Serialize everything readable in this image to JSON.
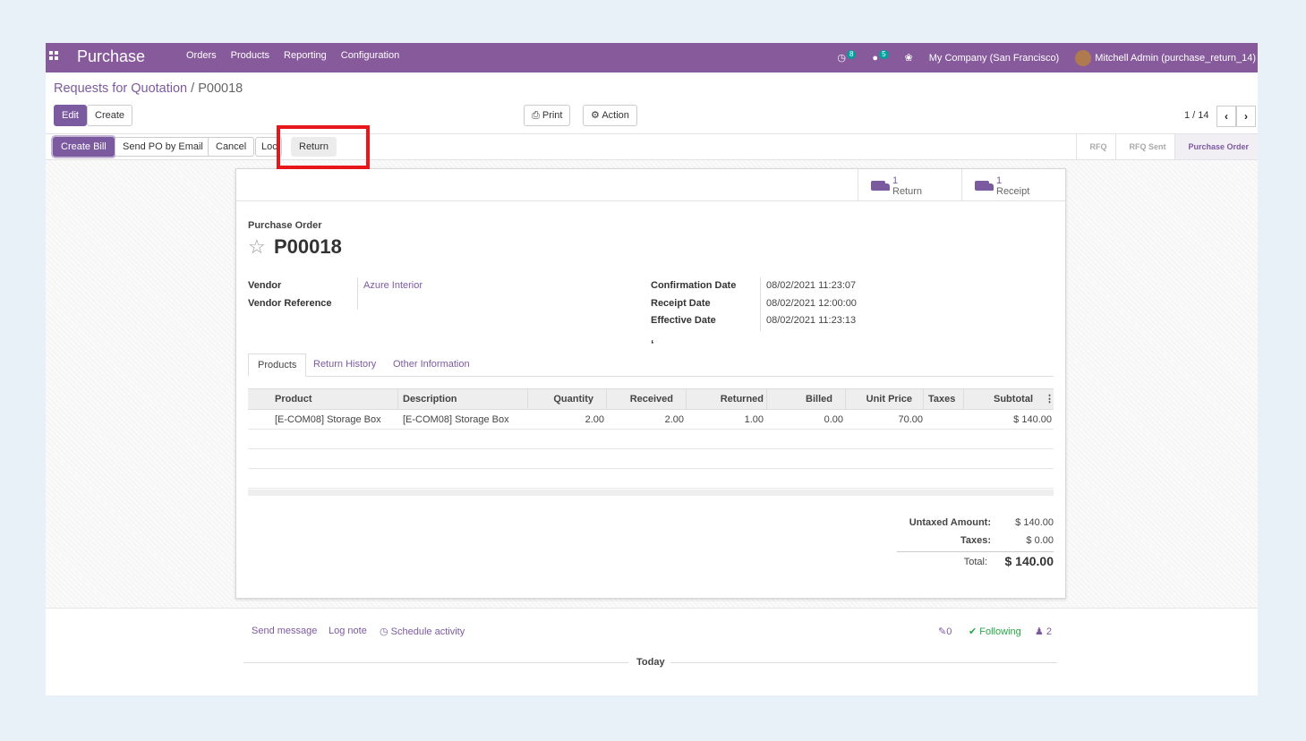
{
  "navbar": {
    "brand": "Purchase",
    "menu": [
      "Orders",
      "Products",
      "Reporting",
      "Configuration"
    ],
    "activity_count": "8",
    "message_count": "5",
    "company": "My Company (San Francisco)",
    "user": "Mitchell Admin (purchase_return_14)"
  },
  "breadcrumb": {
    "parent": "Requests for Quotation",
    "separator": " / ",
    "current": "P00018"
  },
  "toolbar": {
    "edit": "Edit",
    "create": "Create",
    "print": "Print",
    "action": "Action",
    "pager": "1 / 14"
  },
  "statusbar": {
    "buttons": [
      "Create Bill",
      "Send PO by Email",
      "Cancel",
      "Loc",
      "Return"
    ],
    "stages": [
      "RFQ",
      "RFQ Sent",
      "Purchase Order"
    ],
    "active_stage": "Purchase Order"
  },
  "smart_buttons": [
    {
      "count": "1",
      "label": "Return",
      "icon": "truck-icon"
    },
    {
      "count": "1",
      "label": "Receipt",
      "icon": "truck-icon"
    }
  ],
  "form": {
    "type": "Purchase Order",
    "name": "P00018",
    "vendor_label": "Vendor",
    "vendor": "Azure Interior",
    "vendor_ref_label": "Vendor Reference",
    "confirmation_label": "Confirmation Date",
    "confirmation_date": "08/02/2021 11:23:07",
    "receipt_label": "Receipt Date",
    "receipt_date": "08/02/2021 12:00:00",
    "effective_label": "Effective Date",
    "effective_date": "08/02/2021 11:23:13",
    "stray_mark": "‘"
  },
  "tabs": [
    "Products",
    "Return History",
    "Other Information"
  ],
  "lines": {
    "columns": [
      "Product",
      "Description",
      "Quantity",
      "Received",
      "Returned",
      "Billed",
      "Unit Price",
      "Taxes",
      "Subtotal"
    ],
    "rows": [
      [
        "[E-COM08] Storage Box",
        "[E-COM08] Storage Box",
        "2.00",
        "2.00",
        "1.00",
        "0.00",
        "70.00",
        "",
        "$ 140.00"
      ]
    ]
  },
  "totals": {
    "untaxed_label": "Untaxed Amount:",
    "untaxed": "$ 140.00",
    "taxes_label": "Taxes:",
    "taxes": "$ 0.00",
    "total_label": "Total:",
    "total": "$ 140.00"
  },
  "chatter": {
    "send_message": "Send message",
    "log_note": "Log note",
    "schedule": "Schedule activity",
    "attachments": "0",
    "following": "Following",
    "followers": "2",
    "today": "Today"
  }
}
